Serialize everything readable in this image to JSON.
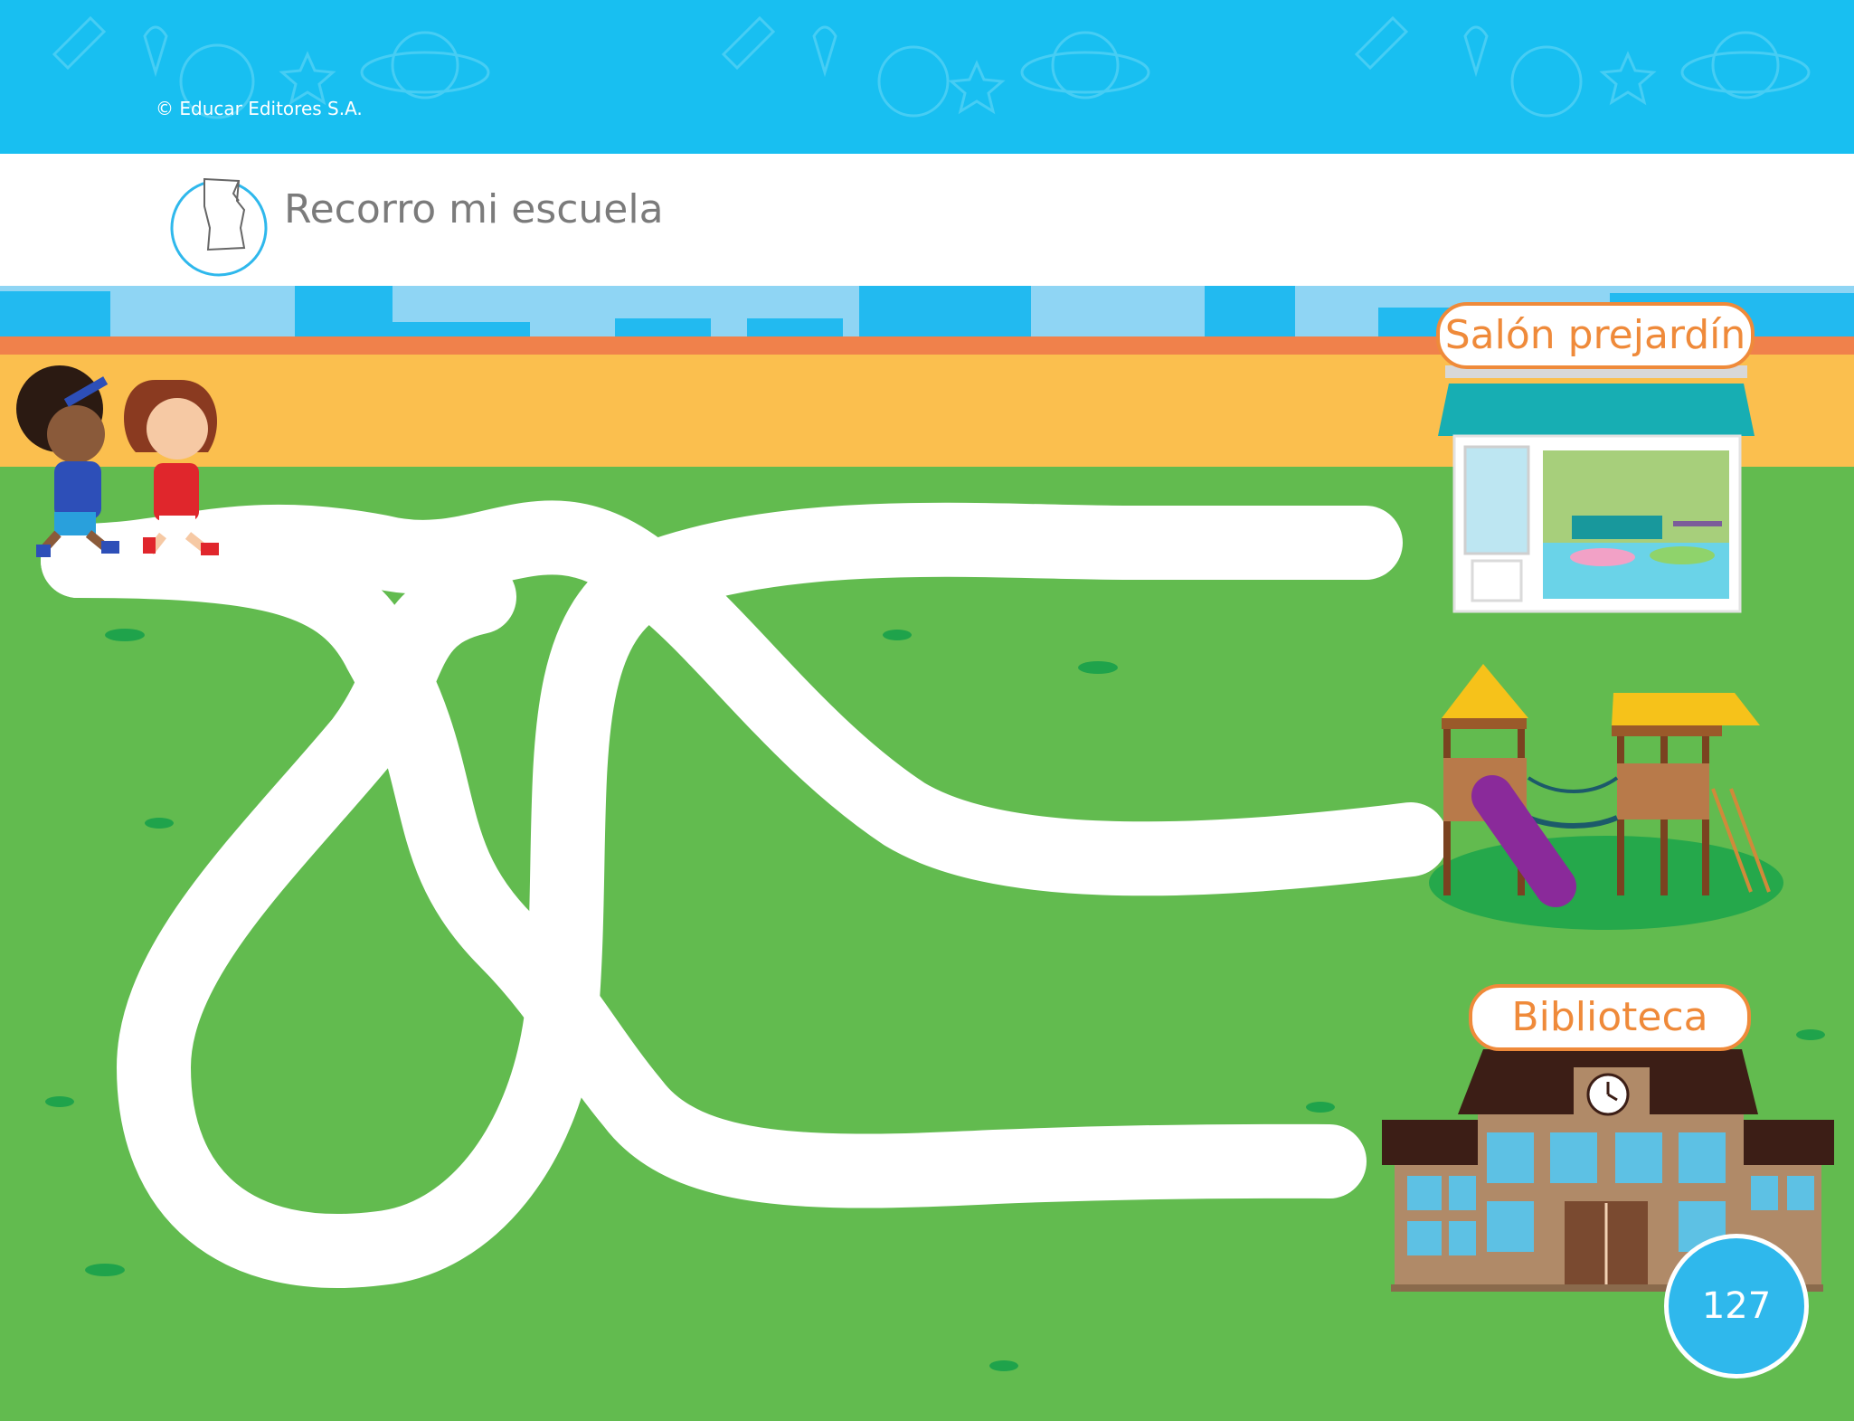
{
  "header": {
    "copyright": "© Educar Editores S.A.",
    "title": "Recorro mi escuela"
  },
  "destinations": {
    "prejardin": "Salón prejardín",
    "biblioteca": "Biblioteca"
  },
  "page_number": "127",
  "icons": [
    "torn-paper-icon",
    "kids-walking",
    "classroom-building",
    "playground",
    "library-building",
    "clock-icon"
  ],
  "colors": {
    "banner": "#18bff1",
    "grass": "#62bb4f",
    "wall": "#fbbf4e",
    "wall_top": "#f0814b",
    "path": "#ffffff",
    "label_orange": "#ef8a3a",
    "badge": "#2fb8ec"
  }
}
